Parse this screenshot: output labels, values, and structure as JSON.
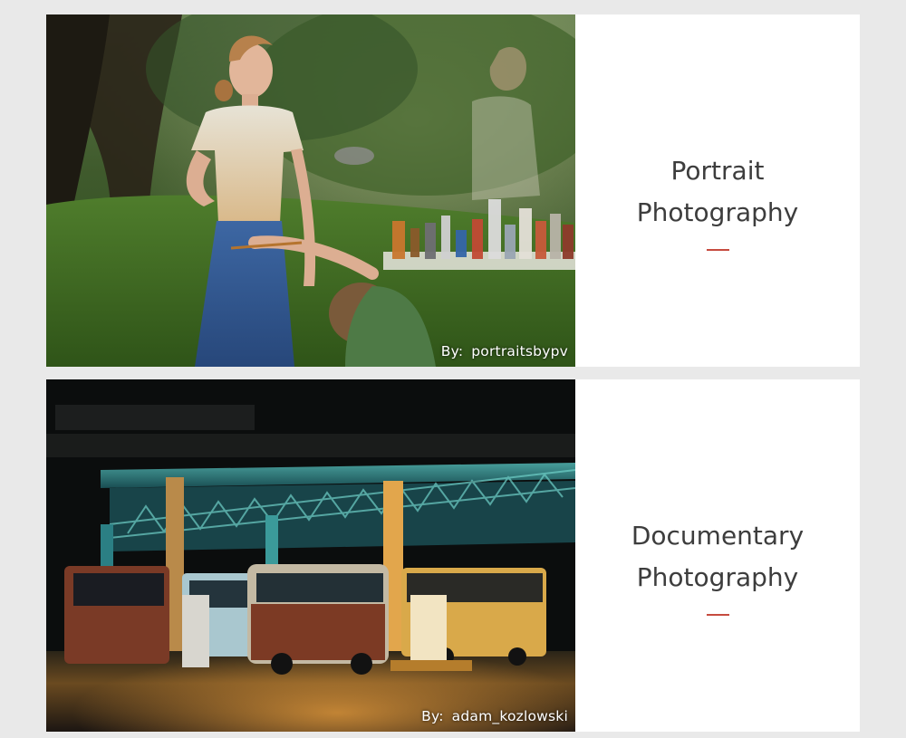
{
  "colors": {
    "page_background": "#e9e9e9",
    "card_background": "#ffffff",
    "title_text": "#3d3d3d",
    "accent": "#c64b3f",
    "credit_text": "#ffffff"
  },
  "cards": [
    {
      "title_line1": "Portrait",
      "title_line2": "Photography",
      "credit_prefix": "By:",
      "credit_author": "portraitsbypv",
      "image": "woman-painted-shirt-garden-photo"
    },
    {
      "title_line1": "Documentary",
      "title_line2": "Photography",
      "credit_prefix": "By:",
      "credit_author": "adam_kozlowski",
      "image": "night-bus-station-photo"
    }
  ]
}
